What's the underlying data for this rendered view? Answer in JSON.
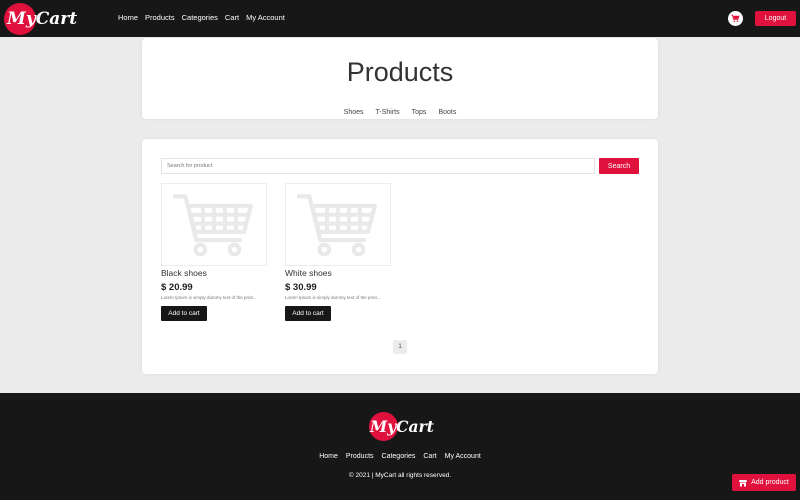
{
  "brand": {
    "logo_text": "MyCart"
  },
  "nav": {
    "links": [
      "Home",
      "Products",
      "Categories",
      "Cart",
      "My Account"
    ],
    "cart_icon": "cart-icon",
    "logout_label": "Logout"
  },
  "hero": {
    "title": "Products",
    "categories": [
      "Shoes",
      "T-Shirts",
      "Tops",
      "Boots"
    ]
  },
  "search": {
    "placeholder": "Search for product",
    "value": "",
    "button_label": "Search"
  },
  "products": [
    {
      "name": "Black shoes",
      "price": "$ 20.99",
      "description": "Lorem Ipsum is simply dummy text of the print...",
      "button_label": "Add to cart",
      "image_icon": "shopping-cart-placeholder-icon"
    },
    {
      "name": "White shoes",
      "price": "$ 30.99",
      "description": "Lorem Ipsum is simply dummy text of the print...",
      "button_label": "Add to cart",
      "image_icon": "shopping-cart-placeholder-icon"
    }
  ],
  "pagination": {
    "current_page": "1"
  },
  "footer": {
    "logo_text": "MyCart",
    "links": [
      "Home",
      "Products",
      "Categories",
      "Cart",
      "My Account"
    ],
    "copyright": "© 2021 | MyCart all rights reserved."
  },
  "floating": {
    "add_product_label": "Add product",
    "icon": "store-icon"
  },
  "colors": {
    "accent": "#e0123d",
    "dark": "#171717",
    "background": "#ebebeb"
  }
}
